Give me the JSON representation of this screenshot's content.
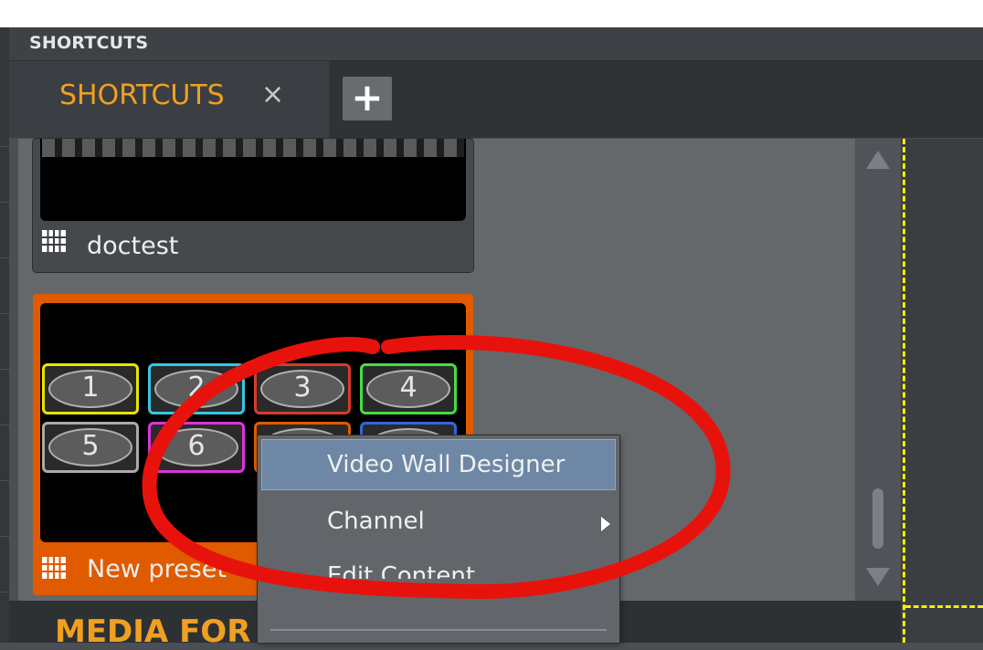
{
  "panel": {
    "title": "SHORTCUTS"
  },
  "tabs": [
    {
      "label": "SHORTCUTS",
      "close": "×",
      "active": true
    }
  ],
  "add_tab": {
    "label": "+"
  },
  "presets": [
    {
      "name": "doctest",
      "icon": "grid-preset-icon",
      "selected": false
    },
    {
      "name": "New preset",
      "icon": "grid-preset-icon",
      "selected": true,
      "cells": [
        {
          "n": "1",
          "color": "#e6e600"
        },
        {
          "n": "2",
          "color": "#33c8e6"
        },
        {
          "n": "3",
          "color": "#d83a2a"
        },
        {
          "n": "4",
          "color": "#44dd44"
        },
        {
          "n": "5",
          "color": "#aaaaaa"
        },
        {
          "n": "6",
          "color": "#dd33dd"
        },
        {
          "n": "",
          "color": "#e05a00"
        },
        {
          "n": "",
          "color": "#3366dd"
        }
      ]
    }
  ],
  "context_menu": {
    "items": [
      {
        "label": "Video Wall Designer",
        "highlighted": true
      },
      {
        "label": "Channel",
        "has_submenu": true
      },
      {
        "label": "Edit Content"
      }
    ]
  },
  "bottom_panel": {
    "label": "MEDIA FOR"
  },
  "colors": {
    "accent": "#f0a020",
    "selected_card": "#e05a00",
    "annotation": "#e8120c",
    "guide": "#ffee00"
  }
}
